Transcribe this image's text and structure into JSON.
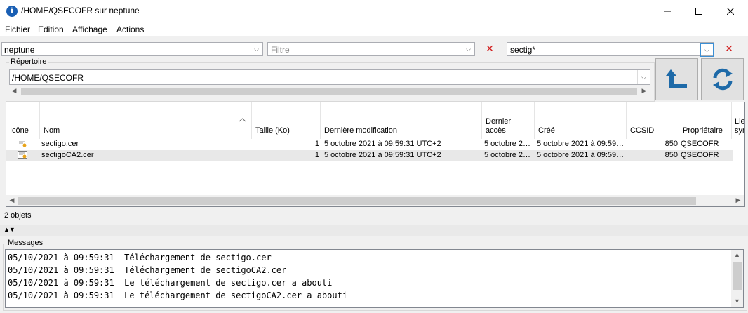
{
  "window": {
    "title": "/HOME/QSECOFR sur neptune"
  },
  "menu": [
    {
      "label": "Fichier"
    },
    {
      "label": "Edition"
    },
    {
      "label": "Affichage"
    },
    {
      "label": "Actions"
    }
  ],
  "toolbar": {
    "system_value": "neptune",
    "filter_placeholder": "Filtre",
    "search_value": "sectig*"
  },
  "directory": {
    "label": "Répertoire",
    "path": "/HOME/QSECOFR"
  },
  "table": {
    "columns": [
      {
        "label": "Icône"
      },
      {
        "label": "Nom"
      },
      {
        "label": "Taille (Ko)"
      },
      {
        "label": "Dernière modification"
      },
      {
        "label": "Dernier accès"
      },
      {
        "label": "Créé"
      },
      {
        "label": "CCSID"
      },
      {
        "label": "Propriétaire"
      },
      {
        "label": "Lien symb"
      }
    ],
    "rows": [
      {
        "name": "sectigo.cer",
        "size": "1",
        "modified": "5 octobre 2021 à 09:59:31 UTC+2",
        "accessed": "5 octobre 2…",
        "created": "5 octobre 2021 à 09:59…",
        "ccsid": "850",
        "owner": "QSECOFR"
      },
      {
        "name": "sectigoCA2.cer",
        "size": "1",
        "modified": "5 octobre 2021 à 09:59:31 UTC+2",
        "accessed": "5 octobre 2…",
        "created": "5 octobre 2021 à 09:59…",
        "ccsid": "850",
        "owner": "QSECOFR"
      }
    ]
  },
  "status": {
    "count": "2 objets"
  },
  "messages": {
    "label": "Messages",
    "lines": [
      "05/10/2021 à 09:59:31  Téléchargement de sectigo.cer",
      "05/10/2021 à 09:59:31  Téléchargement de sectigoCA2.cer",
      "05/10/2021 à 09:59:31  Le téléchargement de sectigo.cer a abouti",
      "05/10/2021 à 09:59:31  Le téléchargement de sectigoCA2.cer a abouti"
    ]
  },
  "colors": {
    "accent": "#1e6aa8",
    "clear": "#d21f1f",
    "selected_row": "#e8e8e8"
  }
}
